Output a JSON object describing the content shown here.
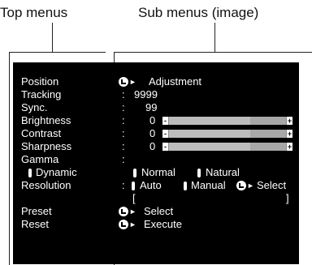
{
  "captions": {
    "left": "Top menus",
    "right": "Sub menus (image)"
  },
  "menu": [
    {
      "label": "Position",
      "value": "Adjustment"
    },
    {
      "label": "Tracking",
      "colon": ":",
      "value": "9999"
    },
    {
      "label": "Sync.",
      "colon": ":",
      "value": "99"
    },
    {
      "label": "Brightness",
      "colon": ":",
      "value": "0",
      "level": 0.5
    },
    {
      "label": "Contrast",
      "colon": ":",
      "value": "0",
      "level": 0.5
    },
    {
      "label": "Sharpness",
      "colon": ":",
      "value": "0",
      "level": 0.5
    },
    {
      "label": "Gamma",
      "colon": ":"
    }
  ],
  "gamma_options": {
    "dynamic": "Dynamic",
    "normal": "Normal",
    "natural": "Natural"
  },
  "resolution": {
    "label": "Resolution",
    "colon": ":",
    "auto": "Auto",
    "manual": "Manual",
    "select": "Select",
    "bracket_open": "[",
    "bracket_close": "]"
  },
  "preset": {
    "label": "Preset",
    "action": "Select"
  },
  "reset": {
    "label": "Reset",
    "action": "Execute"
  },
  "icons": {
    "enter": "enter-arrow-icon"
  }
}
